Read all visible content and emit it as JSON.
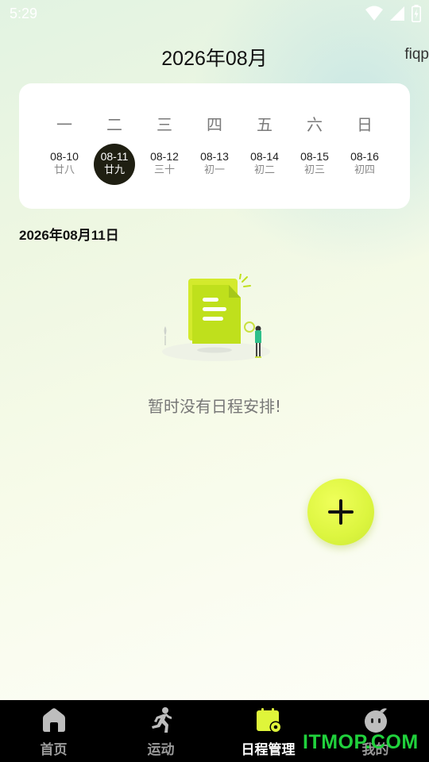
{
  "status_bar": {
    "time": "5:29"
  },
  "header": {
    "month_title": "2026年08月",
    "user_label": "fiqp"
  },
  "week": {
    "weekdays": [
      "一",
      "二",
      "三",
      "四",
      "五",
      "六",
      "日"
    ],
    "days": [
      {
        "date": "08-10",
        "lunar": "廿八"
      },
      {
        "date": "08-11",
        "lunar": "廿九",
        "selected": true
      },
      {
        "date": "08-12",
        "lunar": "三十"
      },
      {
        "date": "08-13",
        "lunar": "初一"
      },
      {
        "date": "08-14",
        "lunar": "初二"
      },
      {
        "date": "08-15",
        "lunar": "初三"
      },
      {
        "date": "08-16",
        "lunar": "初四"
      }
    ]
  },
  "selected_date": "2026年08月11日",
  "empty_state": {
    "text": "暂时没有日程安排!"
  },
  "fab": {
    "icon": "plus-icon",
    "accent": "#dcf53f"
  },
  "bottom_nav": {
    "items": [
      {
        "label": "首页",
        "icon": "home-icon"
      },
      {
        "label": "运动",
        "icon": "running-icon"
      },
      {
        "label": "日程管理",
        "icon": "calendar-icon",
        "active": true
      },
      {
        "label": "我的",
        "icon": "profile-icon"
      }
    ]
  },
  "watermark": "ITMOP.COM"
}
